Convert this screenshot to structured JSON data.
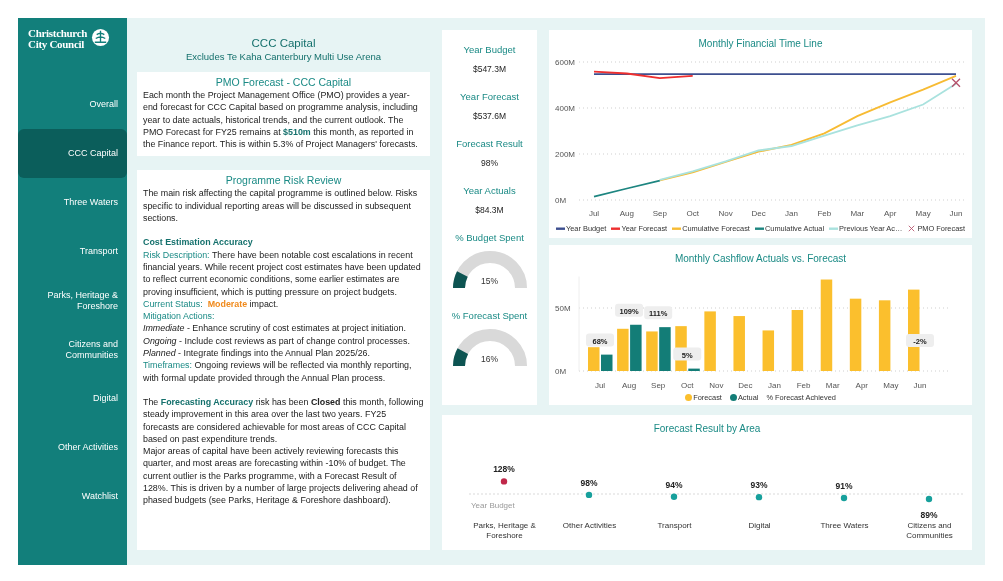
{
  "logo": {
    "lines": [
      "Christchurch",
      "City Council"
    ]
  },
  "sidebar": {
    "items": [
      {
        "label": "Overall",
        "selected": false
      },
      {
        "label": "CCC Capital",
        "selected": true
      },
      {
        "label": "Three Waters",
        "selected": false
      },
      {
        "label": "Transport",
        "selected": false
      },
      {
        "label": "Parks, Heritage & Foreshore",
        "selected": false
      },
      {
        "label": "Citizens and Communities",
        "selected": false
      },
      {
        "label": "Digital",
        "selected": false
      },
      {
        "label": "Other Activities",
        "selected": false
      },
      {
        "label": "Watchlist",
        "selected": false
      }
    ]
  },
  "header": {
    "title": "CCC Capital",
    "subtitle": "Excludes Te Kaha Canterbury Multi Use Arena"
  },
  "pmo_forecast": {
    "title": "PMO Forecast - CCC Capital",
    "paragraph": [
      {
        "text": "Each month the Project Management Office (PMO) provides a year-end forecast for CCC Capital based on programme analysis, including year to date actuals, historical trends, and the current outlook.  The PMO Forecast for FY25 remains at "
      },
      {
        "text": "$510m",
        "kind": "highlight"
      },
      {
        "text": " this month, as reported in the Finance report. This is within 5.3% of Project Managers' forecasts."
      }
    ]
  },
  "risk_review": {
    "title": "Programme Risk Review",
    "blocks": [
      [
        [
          {
            "text": "The main risk affecting the capital programme is outlined below. Risks specific to individual reporting areas will be discussed in subsequent sections."
          }
        ]
      ],
      [
        [
          {
            "text": "Cost Estimation Accuracy",
            "kind": "heading"
          }
        ],
        [
          {
            "text": "Risk Description:",
            "kind": "label"
          },
          {
            "text": "  There have been notable cost escalations in recent financial years.  While recent project cost estimates have been updated to reflect current economic conditions, some earlier estimates are proving insufficient, which is putting pressure on project budgets."
          }
        ],
        [
          {
            "text": "Current Status:",
            "kind": "label"
          },
          {
            "text": "Moderate",
            "kind": "warning"
          },
          {
            "text": " impact."
          }
        ],
        [
          {
            "text": "Mitigation Actions:",
            "kind": "label"
          }
        ],
        [
          {
            "text": "Immediate",
            "kind": "italic"
          },
          {
            "text": " - Enhance scrutiny of cost estimates at project initiation."
          }
        ],
        [
          {
            "text": "Ongoing",
            "kind": "italic"
          },
          {
            "text": " - Include cost reviews as part of change control processes."
          }
        ],
        [
          {
            "text": "Planned",
            "kind": "italic"
          },
          {
            "text": " - Integrate findings into the Annual Plan 2025/26."
          }
        ],
        [
          {
            "text": "Timeframes:",
            "kind": "label"
          },
          {
            "text": "  Ongoing reviews will be reflected via monthly reporting, with formal update provided through the Annual Plan process."
          }
        ]
      ],
      [
        [
          {
            "text": "The "
          },
          {
            "text": "Forecasting Accuracy",
            "kind": "highlight"
          },
          {
            "text": " risk has been "
          },
          {
            "text": "Closed",
            "kind": "bold"
          },
          {
            "text": " this month, following steady improvement in this area over the last two years. FY25 forecasts are considered achievable for most areas of CCC Capital based on past expenditure trends."
          }
        ],
        [
          {
            "text": "Major areas of capital have been actively reviewing forecasts this quarter, and most areas are forecasting within -10% of budget.  The current outlier is the Parks programme, with a Forecast Result of 128%. This is driven by a number of large projects delivering ahead of phased budgets (see Parks, Heritage & Foreshore dashboard)."
          }
        ]
      ]
    ]
  },
  "kpis": [
    {
      "kind": "value",
      "label": "Year Budget",
      "value": "$547.3M"
    },
    {
      "kind": "value",
      "label": "Year Forecast",
      "value": "$537.6M"
    },
    {
      "kind": "value",
      "label": "Forecast Result",
      "value": "98%"
    },
    {
      "kind": "value",
      "label": "Year Actuals",
      "value": "$84.3M"
    },
    {
      "kind": "gauge",
      "label": "% Budget Spent",
      "value": "15%"
    },
    {
      "kind": "gauge",
      "label": "% Forecast Spent",
      "value": "16%"
    }
  ],
  "timeline": {
    "chart_data": {
      "type": "line",
      "title": "Monthly Financial Time Line",
      "categories": [
        "Jul",
        "Aug",
        "Sep",
        "Oct",
        "Nov",
        "Dec",
        "Jan",
        "Feb",
        "Mar",
        "Apr",
        "May",
        "Jun"
      ],
      "yticks": [
        {
          "value": 0,
          "label": "0M"
        },
        {
          "value": 200,
          "label": "200M"
        },
        {
          "value": 400,
          "label": "400M"
        },
        {
          "value": 600,
          "label": "600M"
        }
      ],
      "ylim": [
        0,
        600
      ],
      "legend": "bottom",
      "series": [
        {
          "name": "Year Budget",
          "color": "#3d4f8f",
          "values": [
            547,
            547,
            547,
            547,
            547,
            547,
            547,
            547,
            547,
            547,
            547,
            547
          ]
        },
        {
          "name": "Year Forecast",
          "color": "#ee2f2f",
          "values": [
            558,
            550,
            530,
            540,
            null,
            null,
            null,
            null,
            null,
            null,
            null,
            null
          ]
        },
        {
          "name": "Cumulative Forecast",
          "color": "#f7bb33",
          "values": [
            null,
            null,
            85,
            120,
            165,
            210,
            240,
            290,
            365,
            425,
            480,
            540
          ]
        },
        {
          "name": "Cumulative Actual",
          "color": "#1d8580",
          "values": [
            15,
            50,
            84,
            null,
            null,
            null,
            null,
            null,
            null,
            null,
            null,
            null
          ]
        },
        {
          "name": "Previous Year Ac…",
          "color": "#a9e2de",
          "values": [
            null,
            null,
            88,
            125,
            168,
            215,
            235,
            280,
            325,
            365,
            415,
            505
          ]
        },
        {
          "name": "PMO Forecast",
          "color": "#b5506a",
          "marker": "x",
          "values": [
            null,
            null,
            null,
            null,
            null,
            null,
            null,
            null,
            null,
            null,
            null,
            510
          ]
        }
      ]
    }
  },
  "cashflow": {
    "chart_data": {
      "type": "bar",
      "title": "Monthly Cashflow Actuals vs. Forecast",
      "categories": [
        "Jul",
        "Aug",
        "Sep",
        "Oct",
        "Nov",
        "Dec",
        "Jan",
        "Feb",
        "Mar",
        "Apr",
        "May",
        "Jun"
      ],
      "yticks": [
        {
          "value": 0,
          "label": "0M"
        },
        {
          "value": 50,
          "label": "50M"
        }
      ],
      "ylim": [
        0,
        75
      ],
      "series": [
        {
          "name": "Forecast",
          "color": "#fbbf2d",
          "values": [
            18.9,
            33.5,
            31.4,
            35.6,
            47.3,
            43.6,
            32.2,
            48.4,
            72.6,
            57.4,
            56.1,
            64.6
          ]
        },
        {
          "name": "Actual",
          "color": "#137d77",
          "values": [
            13,
            36.7,
            34.8,
            1.9,
            null,
            null,
            null,
            null,
            null,
            null,
            null,
            null
          ]
        },
        {
          "name": "% Forecast Achieved",
          "values": [
            null,
            null,
            null,
            null,
            null,
            null,
            null,
            null,
            null,
            null,
            null,
            null
          ]
        }
      ],
      "legend": "bottom",
      "annotations": [
        {
          "x": "Jul",
          "text": "68%"
        },
        {
          "x": "Aug",
          "text": "109%"
        },
        {
          "x": "Sep",
          "text": "111%"
        },
        {
          "x": "Oct",
          "text": "5%"
        },
        {
          "x": "Jun",
          "text": "-2%"
        }
      ]
    }
  },
  "area_result": {
    "chart_data": {
      "type": "scatter",
      "title": "Forecast Result by Area",
      "categories": [
        "Parks, Heritage & Foreshore",
        "Other Activities",
        "Transport",
        "Digital",
        "Three Waters",
        "Citizens and Communities"
      ],
      "series": [
        {
          "values": [
            128,
            98,
            94,
            93,
            91,
            89
          ],
          "value_labels": [
            "128%",
            "98%",
            "94%",
            "93%",
            "91%",
            "89%"
          ],
          "colors": [
            "#c0284a",
            "#17a09c",
            "#17a09c",
            "#17a09c",
            "#17a09c",
            "#17a09c"
          ]
        }
      ],
      "ref_lines": [
        {
          "label": "Year Budget"
        }
      ]
    }
  }
}
